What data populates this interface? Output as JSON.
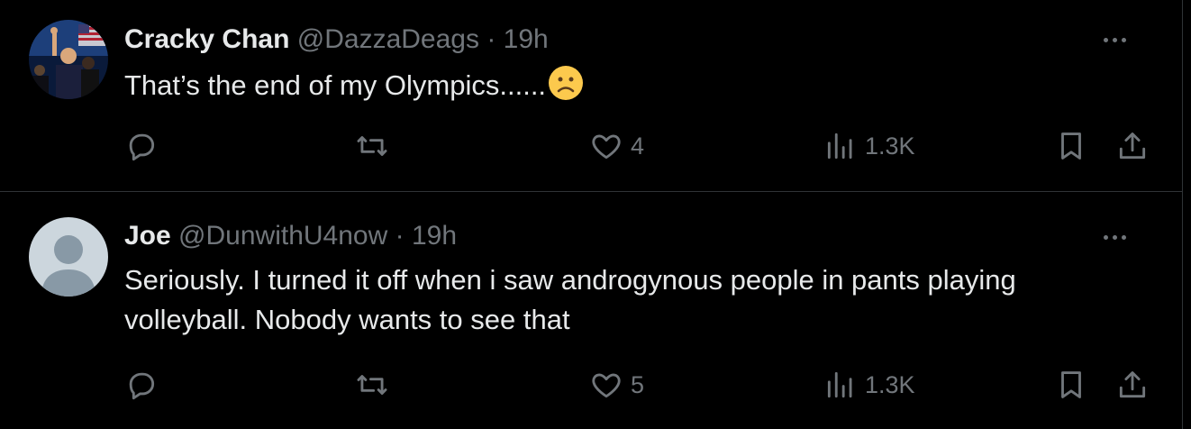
{
  "tweets": [
    {
      "name": "Cracky Chan",
      "handle": "@DazzaDeags",
      "separator": "·",
      "time": "19h",
      "text": "That’s the end of my Olympics......",
      "emoji": "frowning-face-emoji",
      "replies": "",
      "retweets": "",
      "likes": "4",
      "views": "1.3K"
    },
    {
      "name": "Joe",
      "handle": "@DunwithU4now",
      "separator": "·",
      "time": "19h",
      "text": "Seriously. I turned it off when i saw androgynous people in pants playing volleyball. Nobody wants to see that",
      "replies": "",
      "retweets": "",
      "likes": "5",
      "views": "1.3K"
    }
  ],
  "colors": {
    "background": "#000000",
    "primary_text": "#e7e9ea",
    "secondary_text": "#71767b",
    "divider": "#2f3336"
  }
}
